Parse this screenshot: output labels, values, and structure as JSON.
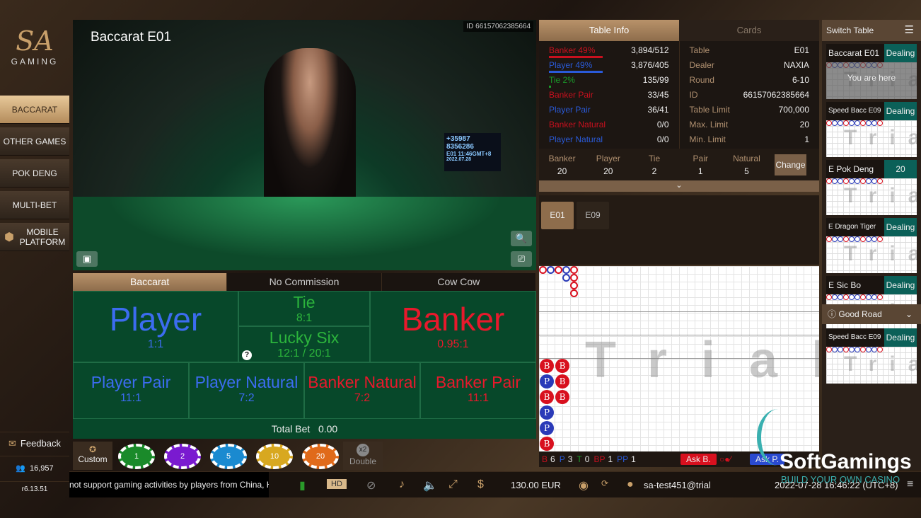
{
  "brand": {
    "logo_text": "SA",
    "logo_sub": "GAMING"
  },
  "sidebar": {
    "items": [
      {
        "label": "BACCARAT",
        "active": true
      },
      {
        "label": "OTHER GAMES"
      },
      {
        "label": "POK DENG"
      },
      {
        "label": "MULTI-BET"
      },
      {
        "label": "MOBILE PLATFORM"
      }
    ],
    "feedback": "Feedback",
    "online_count": "16,957",
    "version": "r6.13.51"
  },
  "video": {
    "title": "Baccarat E01",
    "id": "ID  66157062385664",
    "screen_lines": [
      "+35987",
      "8356286",
      "E01 11:46GMT+8",
      "2022.07.28"
    ]
  },
  "bet_tabs": [
    {
      "label": "Baccarat",
      "active": true
    },
    {
      "label": "No Commission"
    },
    {
      "label": "Cow Cow"
    }
  ],
  "bets": {
    "player": {
      "label": "Player",
      "odds": "1:1"
    },
    "tie": {
      "label": "Tie",
      "odds": "8:1"
    },
    "lucky_six": {
      "label": "Lucky Six",
      "odds": "12:1 / 20:1",
      "help": "?"
    },
    "banker": {
      "label": "Banker",
      "odds": "0.95:1"
    },
    "player_pair": {
      "label": "Player Pair",
      "odds": "11:1"
    },
    "player_natural": {
      "label": "Player Natural",
      "odds": "7:2"
    },
    "banker_natural": {
      "label": "Banker Natural",
      "odds": "7:2"
    },
    "banker_pair": {
      "label": "Banker Pair",
      "odds": "11:1"
    },
    "total_bet_label": "Total Bet",
    "total_bet": "0.00"
  },
  "chips": {
    "custom": "Custom",
    "values": [
      {
        "v": "1",
        "color": "#1a8a2a"
      },
      {
        "v": "2",
        "color": "#7a1ad0"
      },
      {
        "v": "5",
        "color": "#1a8ad0"
      },
      {
        "v": "10",
        "color": "#d8a820"
      },
      {
        "v": "20",
        "color": "#e06a1a"
      }
    ],
    "double_badge": "x2",
    "double": "Double"
  },
  "bottom_bar": {
    "marquee": "not support gaming activities by players from China, Hong",
    "quality": "HD",
    "balance": "130.00 EUR",
    "user": "sa-test451@trial",
    "datetime": "2022-07-28 16:46:22 (UTC+8)"
  },
  "panel": {
    "tabs": [
      {
        "label": "Table Info",
        "active": true
      },
      {
        "label": "Cards"
      }
    ],
    "stats": [
      {
        "label": "Banker 49%",
        "value": "3,894/512",
        "color": "#c8101e",
        "bar": 49
      },
      {
        "label": "Player 49%",
        "value": "3,876/405",
        "color": "#2a5ad8",
        "bar": 49
      },
      {
        "label": "Tie 2%",
        "value": "135/99",
        "color": "#1a9a2a",
        "bar": 2
      },
      {
        "label": "Banker Pair",
        "value": "33/45",
        "color": "#c8101e"
      },
      {
        "label": "Player Pair",
        "value": "36/41",
        "color": "#2a5ad8"
      },
      {
        "label": "Banker Natural",
        "value": "0/0",
        "color": "#c8101e"
      },
      {
        "label": "Player Natural",
        "value": "0/0",
        "color": "#2a5ad8"
      }
    ],
    "details": [
      {
        "k": "Table",
        "v": "E01"
      },
      {
        "k": "Dealer",
        "v": "NAXIA"
      },
      {
        "k": "Round",
        "v": "6-10"
      },
      {
        "k": "ID",
        "v": "66157062385664"
      },
      {
        "k": "Table Limit",
        "v": "700,000"
      },
      {
        "k": "Max. Limit",
        "v": "20"
      },
      {
        "k": "Min. Limit",
        "v": "1"
      }
    ],
    "limits": [
      {
        "k": "Banker",
        "v": "20"
      },
      {
        "k": "Player",
        "v": "20"
      },
      {
        "k": "Tie",
        "v": "2"
      },
      {
        "k": "Pair",
        "v": "1"
      },
      {
        "k": "Natural",
        "v": "5"
      }
    ],
    "change": "Change"
  },
  "road_tabs": [
    {
      "label": "E01",
      "active": true
    },
    {
      "label": "E09"
    }
  ],
  "roads": {
    "watermark": "Trial",
    "bead": [
      [
        "B",
        "P",
        "B",
        "P",
        "P",
        "B"
      ],
      [
        "B",
        "B",
        "B"
      ]
    ],
    "big": [
      [
        "B"
      ],
      [
        "P"
      ],
      [
        "B"
      ],
      [
        "P",
        "P"
      ],
      [
        "B",
        "B",
        "B",
        "B"
      ]
    ],
    "summary": [
      {
        "k": "B",
        "v": "6",
        "c": "#c8101e"
      },
      {
        "k": "P",
        "v": "3",
        "c": "#2a5ad8"
      },
      {
        "k": "T",
        "v": "0",
        "c": "#1a9a2a"
      },
      {
        "k": "BP",
        "v": "1",
        "c": "#c8101e"
      },
      {
        "k": "PP",
        "v": "1",
        "c": "#2a5ad8"
      }
    ],
    "ask_b": "Ask B.",
    "ask_p": "Ask P."
  },
  "right": {
    "title": "Switch Table",
    "good_road": "Good Road",
    "you_are_here": "You are here",
    "tables": [
      {
        "name": "Baccarat E01",
        "status": "Dealing"
      },
      {
        "name": "Speed Bacc E09",
        "status": "Dealing"
      },
      {
        "name": "E Pok Deng",
        "status": "20"
      },
      {
        "name": "E Dragon Tiger",
        "status": "Dealing"
      },
      {
        "name": "E Sic Bo",
        "status": "Dealing"
      }
    ],
    "good_road_tables": [
      {
        "name": "Speed Bacc E09",
        "status": "Dealing"
      }
    ]
  },
  "watermark": {
    "name": "SoftGamings",
    "tagline": "BUILD YOUR OWN CASINO"
  }
}
